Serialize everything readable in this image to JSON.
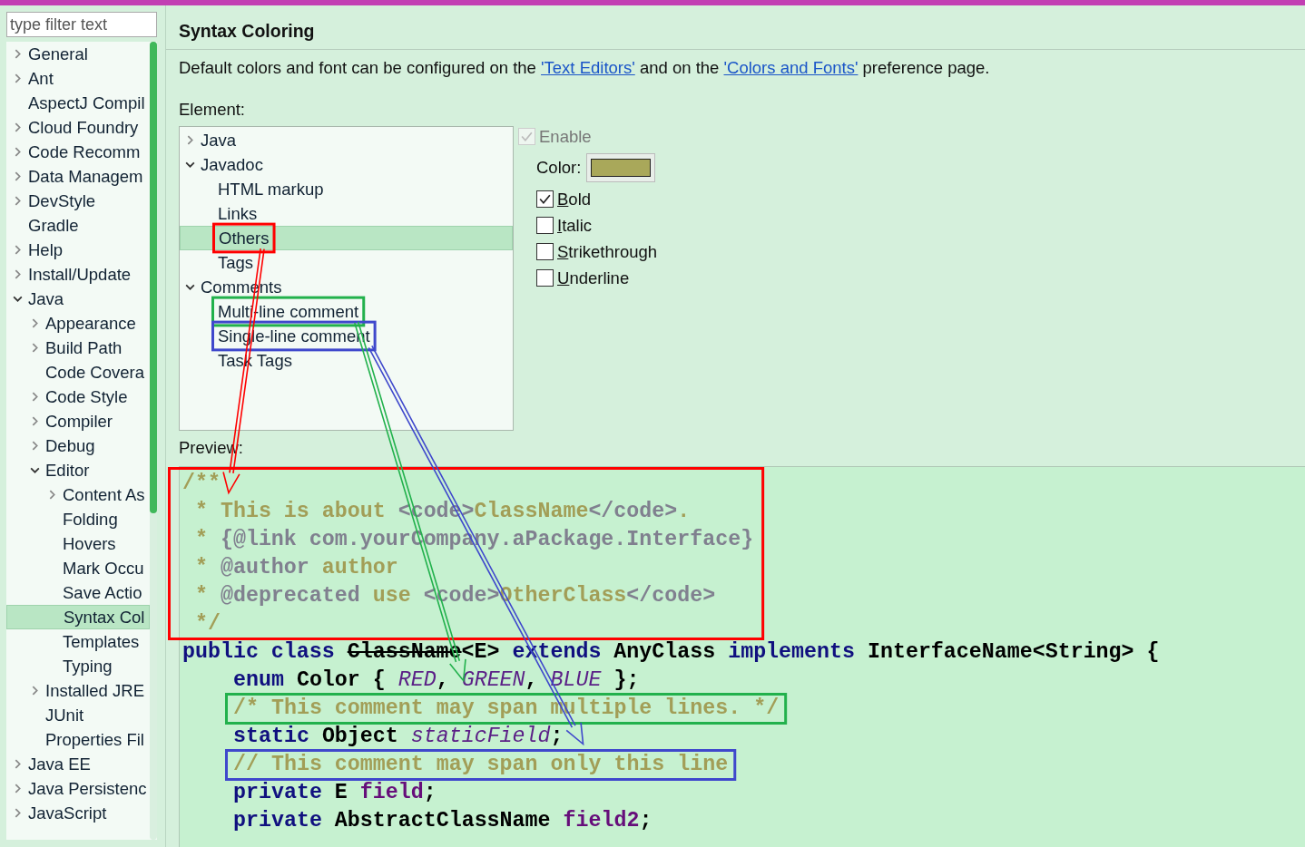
{
  "filter": {
    "placeholder": "type filter text"
  },
  "sidebar": {
    "items": [
      {
        "label": "General",
        "expanded": false,
        "selected": false
      },
      {
        "label": "Ant",
        "expanded": false,
        "selected": false
      },
      {
        "label": "AspectJ Compil",
        "selected": false
      },
      {
        "label": "Cloud Foundry",
        "expanded": false,
        "selected": false
      },
      {
        "label": "Code Recomm",
        "expanded": false,
        "selected": false
      },
      {
        "label": "Data Managem",
        "expanded": false,
        "selected": false
      },
      {
        "label": "DevStyle",
        "expanded": false,
        "selected": false
      },
      {
        "label": "Gradle",
        "selected": false
      },
      {
        "label": "Help",
        "expanded": false,
        "selected": false
      },
      {
        "label": "Install/Update",
        "expanded": false,
        "selected": false
      },
      {
        "label": "Java",
        "expanded": true,
        "selected": false,
        "children": [
          {
            "label": "Appearance",
            "expanded": false,
            "selected": false
          },
          {
            "label": "Build Path",
            "expanded": false,
            "selected": false
          },
          {
            "label": "Code Covera",
            "selected": false
          },
          {
            "label": "Code Style",
            "expanded": false,
            "selected": false
          },
          {
            "label": "Compiler",
            "expanded": false,
            "selected": false
          },
          {
            "label": "Debug",
            "expanded": false,
            "selected": false
          },
          {
            "label": "Editor",
            "expanded": true,
            "selected": false,
            "children": [
              {
                "label": "Content As",
                "expanded": false,
                "selected": false
              },
              {
                "label": "Folding",
                "selected": false
              },
              {
                "label": "Hovers",
                "selected": false
              },
              {
                "label": "Mark Occu",
                "selected": false
              },
              {
                "label": "Save Actio",
                "selected": false
              },
              {
                "label": "Syntax Col",
                "selected": true
              },
              {
                "label": "Templates",
                "selected": false
              },
              {
                "label": "Typing",
                "selected": false
              }
            ]
          },
          {
            "label": "Installed JRE",
            "expanded": false,
            "selected": false
          },
          {
            "label": "JUnit",
            "selected": false
          },
          {
            "label": "Properties Fil",
            "selected": false
          }
        ]
      },
      {
        "label": "Java EE",
        "expanded": false,
        "selected": false
      },
      {
        "label": "Java Persistenc",
        "expanded": false,
        "selected": false
      },
      {
        "label": "JavaScript",
        "expanded": false,
        "selected": false
      }
    ]
  },
  "page": {
    "title": "Syntax Coloring",
    "description": [
      {
        "text": "Default colors and font can be configured on the "
      },
      {
        "text": "'Text Editors'",
        "link": true
      },
      {
        "text": " and on the "
      },
      {
        "text": "'Colors and Fonts'",
        "link": true
      },
      {
        "text": " preference page."
      }
    ],
    "element_label": "Element:",
    "elements": [
      {
        "label": "Java",
        "expanded": false,
        "selected": false
      },
      {
        "label": "Javadoc",
        "expanded": true,
        "selected": false,
        "children": [
          {
            "label": "HTML markup",
            "selected": false
          },
          {
            "label": "Links",
            "selected": false
          },
          {
            "label": "Others",
            "selected": true
          },
          {
            "label": "Tags",
            "selected": false
          }
        ]
      },
      {
        "label": "Comments",
        "expanded": true,
        "selected": false,
        "children": [
          {
            "label": "Multi-line comment",
            "selected": false
          },
          {
            "label": "Single-line comment",
            "selected": false
          },
          {
            "label": "Task Tags",
            "selected": false
          }
        ]
      }
    ],
    "enable": {
      "label": "Enable",
      "checked": true,
      "disabled": true
    },
    "color": {
      "label": "Color:",
      "color": "#a9a85a"
    },
    "styles": [
      {
        "label": "Bold",
        "checked": true
      },
      {
        "label": "Italic",
        "checked": false
      },
      {
        "label": "Strikethrough",
        "checked": false
      },
      {
        "label": "Underline",
        "checked": false
      }
    ],
    "preview_label": "Preview:"
  },
  "preview": {
    "lines": [
      {
        "indented": false,
        "tokens": [
          {
            "text": "/**",
            "kind": "javadoc"
          }
        ]
      },
      {
        "indented": false,
        "tokens": [
          {
            "text": " * This is about ",
            "kind": "javadoc"
          },
          {
            "text": "<code>",
            "kind": "doc_tag"
          },
          {
            "text": "ClassName",
            "kind": "javadoc"
          },
          {
            "text": "</code>",
            "kind": "doc_tag"
          },
          {
            "text": ".",
            "kind": "javadoc"
          }
        ]
      },
      {
        "indented": false,
        "tokens": [
          {
            "text": " * ",
            "kind": "javadoc"
          },
          {
            "text": "{@link com.yourCompany.aPackage.Interface}",
            "kind": "doc_tag"
          }
        ]
      },
      {
        "indented": false,
        "tokens": [
          {
            "text": " * ",
            "kind": "javadoc"
          },
          {
            "text": "@author",
            "kind": "doc_tag"
          },
          {
            "text": " author",
            "kind": "javadoc"
          }
        ]
      },
      {
        "indented": false,
        "tokens": [
          {
            "text": " * ",
            "kind": "javadoc"
          },
          {
            "text": "@deprecated",
            "kind": "doc_tag"
          },
          {
            "text": " use ",
            "kind": "javadoc"
          },
          {
            "text": "<code>",
            "kind": "doc_tag"
          },
          {
            "text": "OtherClass",
            "kind": "javadoc"
          },
          {
            "text": "</code>",
            "kind": "doc_tag"
          }
        ]
      },
      {
        "indented": false,
        "tokens": [
          {
            "text": " */",
            "kind": "javadoc"
          }
        ]
      },
      {
        "indented": false,
        "tokens": [
          {
            "text": "public class ",
            "kind": "keyword"
          },
          {
            "text": "ClassName",
            "kind": "deprecated"
          },
          {
            "text": "<E> ",
            "kind": "plain"
          },
          {
            "text": "extends ",
            "kind": "keyword"
          },
          {
            "text": "AnyClass ",
            "kind": "plain"
          },
          {
            "text": "implements ",
            "kind": "keyword"
          },
          {
            "text": "InterfaceName<String> {",
            "kind": "plain"
          }
        ]
      },
      {
        "indented": true,
        "tokens": [
          {
            "text": "enum ",
            "kind": "keyword"
          },
          {
            "text": "Color { ",
            "kind": "plain"
          },
          {
            "text": "RED",
            "kind": "enum"
          },
          {
            "text": ", ",
            "kind": "plain"
          },
          {
            "text": "GREEN",
            "kind": "enum"
          },
          {
            "text": ", ",
            "kind": "plain"
          },
          {
            "text": "BLUE",
            "kind": "enum"
          },
          {
            "text": " };",
            "kind": "plain"
          }
        ]
      },
      {
        "indented": true,
        "tokens": [
          {
            "text": "/* This comment may span multiple lines. */",
            "kind": "comment"
          }
        ]
      },
      {
        "indented": true,
        "tokens": [
          {
            "text": "static ",
            "kind": "keyword"
          },
          {
            "text": "Object ",
            "kind": "plain"
          },
          {
            "text": "staticField",
            "kind": "static_field"
          },
          {
            "text": ";",
            "kind": "plain"
          }
        ]
      },
      {
        "indented": true,
        "tokens": [
          {
            "text": "// This comment may span only this line",
            "kind": "comment"
          }
        ]
      },
      {
        "indented": true,
        "tokens": [
          {
            "text": "private ",
            "kind": "keyword"
          },
          {
            "text": "E ",
            "kind": "plain"
          },
          {
            "text": "field",
            "kind": "field"
          },
          {
            "text": ";",
            "kind": "plain"
          }
        ]
      },
      {
        "indented": true,
        "tokens": [
          {
            "text": "private ",
            "kind": "keyword"
          },
          {
            "text": "AbstractClassName ",
            "kind": "plain"
          },
          {
            "text": "field2",
            "kind": "field"
          },
          {
            "text": ";",
            "kind": "plain"
          }
        ]
      }
    ]
  },
  "annotations": [
    {
      "kind": "box",
      "color": "#ff0000"
    },
    {
      "kind": "box",
      "color": "#22b14c"
    },
    {
      "kind": "box",
      "color": "#3f48cc"
    },
    {
      "kind": "box",
      "color": "#ff0000"
    },
    {
      "kind": "box",
      "color": "#22b14c"
    },
    {
      "kind": "box",
      "color": "#3f48cc"
    },
    {
      "kind": "arrow",
      "color": "#ff0000"
    },
    {
      "kind": "arrow",
      "color": "#22b14c"
    },
    {
      "kind": "arrow",
      "color": "#3f48cc"
    }
  ]
}
